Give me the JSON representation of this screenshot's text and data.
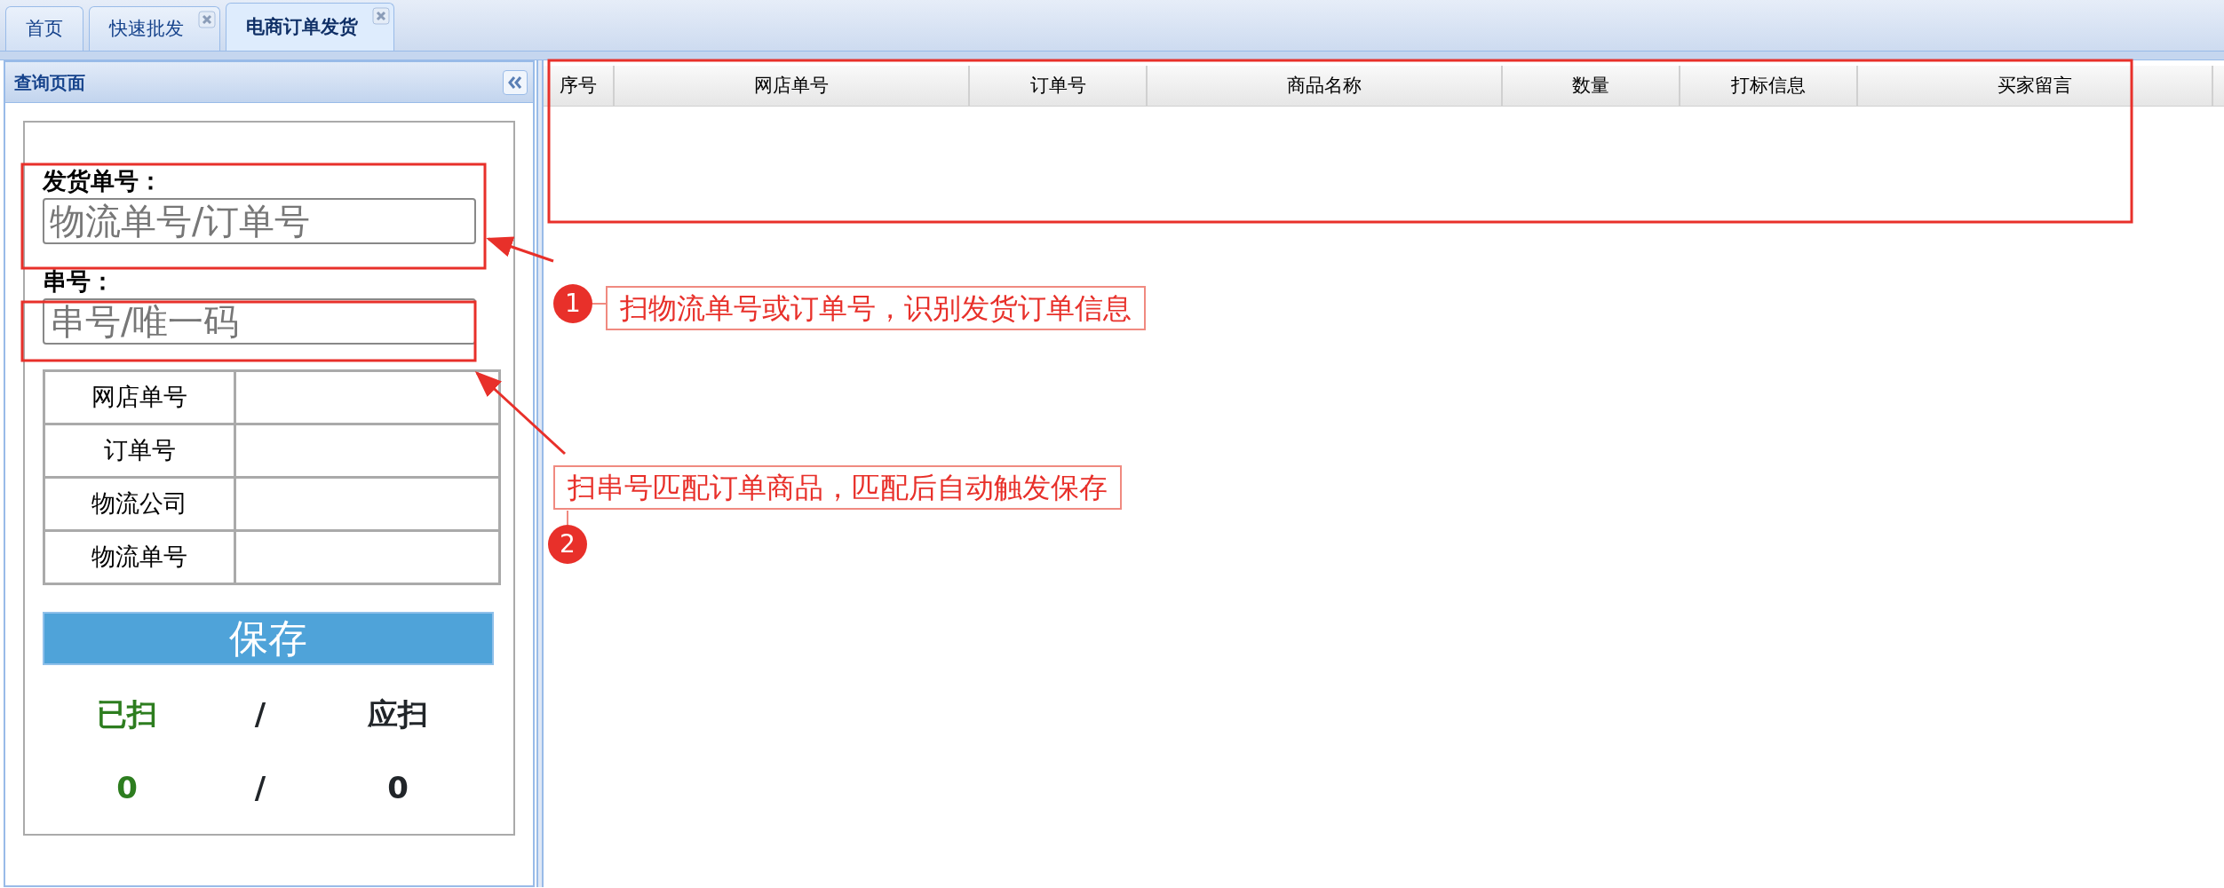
{
  "tabs": [
    {
      "label": "首页",
      "closable": false,
      "selected": false
    },
    {
      "label": "快速批发",
      "closable": true,
      "selected": false
    },
    {
      "label": "电商订单发货",
      "closable": true,
      "selected": true
    }
  ],
  "query_panel": {
    "title": "查询页面",
    "fields": [
      {
        "label": "发货单号：",
        "placeholder": "物流单号/订单号"
      },
      {
        "label": "串号：",
        "placeholder": "串号/唯一码"
      }
    ],
    "info_rows": [
      {
        "label": "网店单号"
      },
      {
        "label": "订单号"
      },
      {
        "label": "物流公司"
      },
      {
        "label": "物流单号"
      }
    ],
    "save_button": "保存",
    "scan_counter": {
      "scanned_label": "已扫",
      "separator": "/",
      "expected_label": "应扫",
      "scanned": "0",
      "separator_2": "/",
      "expected": "0"
    }
  },
  "table": {
    "columns": [
      "序号",
      "网店单号",
      "订单号",
      "商品名称",
      "数量",
      "打标信息",
      "买家留言"
    ]
  },
  "annotations": [
    {
      "number": "1",
      "text": "扫物流单号或订单号，识别发货订单信息"
    },
    {
      "number": "2",
      "text": "扫串号匹配订单商品，匹配后自动触发保存"
    }
  ]
}
